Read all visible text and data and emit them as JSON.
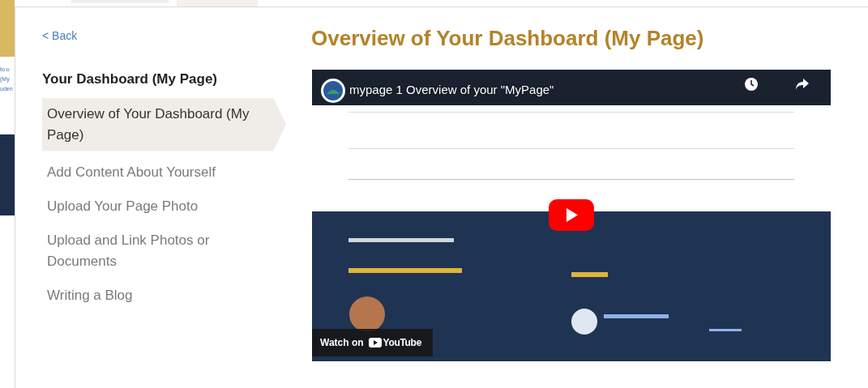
{
  "background_page": {
    "link_fragments": [
      "to u",
      "(My",
      "uden"
    ]
  },
  "back_link": "< Back",
  "sidebar": {
    "title": "Your Dashboard (My Page)",
    "items": [
      {
        "label": "Overview of Your Dashboard (My Page)",
        "selected": true
      },
      {
        "label": "Add Content About Yourself",
        "selected": false
      },
      {
        "label": "Upload Your Page Photo",
        "selected": false
      },
      {
        "label": "Upload and Link Photos or Documents",
        "selected": false
      },
      {
        "label": "Writing a Blog",
        "selected": false
      }
    ]
  },
  "heading": "Overview of Your Dashboard (My Page)",
  "video": {
    "title": "mypage 1 Overview of your \"MyPage\"",
    "watch_on": "Watch on",
    "platform": "YouTube"
  }
}
